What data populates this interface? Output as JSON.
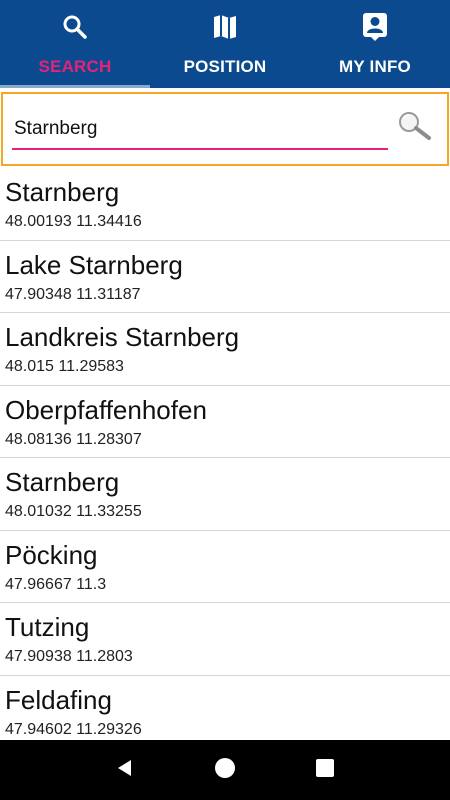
{
  "tabs": [
    {
      "label": "SEARCH",
      "icon": "search-icon",
      "active": true
    },
    {
      "label": "POSITION",
      "icon": "map-icon",
      "active": false
    },
    {
      "label": "MY INFO",
      "icon": "account-icon",
      "active": false
    }
  ],
  "colors": {
    "tabbar_bg": "#0b4a8e",
    "active_tab": "#e8207a",
    "search_border": "#f5a623",
    "input_underline": "#e8207a"
  },
  "search": {
    "value": "Starnberg",
    "button_icon": "magnifier-icon"
  },
  "results": [
    {
      "name": "Starnberg",
      "coords": "48.00193 11.34416"
    },
    {
      "name": "Lake Starnberg",
      "coords": "47.90348 11.31187"
    },
    {
      "name": "Landkreis Starnberg",
      "coords": "48.015 11.29583"
    },
    {
      "name": "Oberpfaffenhofen",
      "coords": "48.08136 11.28307"
    },
    {
      "name": "Starnberg",
      "coords": "48.01032 11.33255"
    },
    {
      "name": "Pöcking",
      "coords": "47.96667 11.3"
    },
    {
      "name": "Tutzing",
      "coords": "47.90938 11.2803"
    },
    {
      "name": "Feldafing",
      "coords": "47.94602 11.29326"
    }
  ],
  "navbar": [
    "back-icon",
    "home-icon",
    "recents-icon"
  ]
}
